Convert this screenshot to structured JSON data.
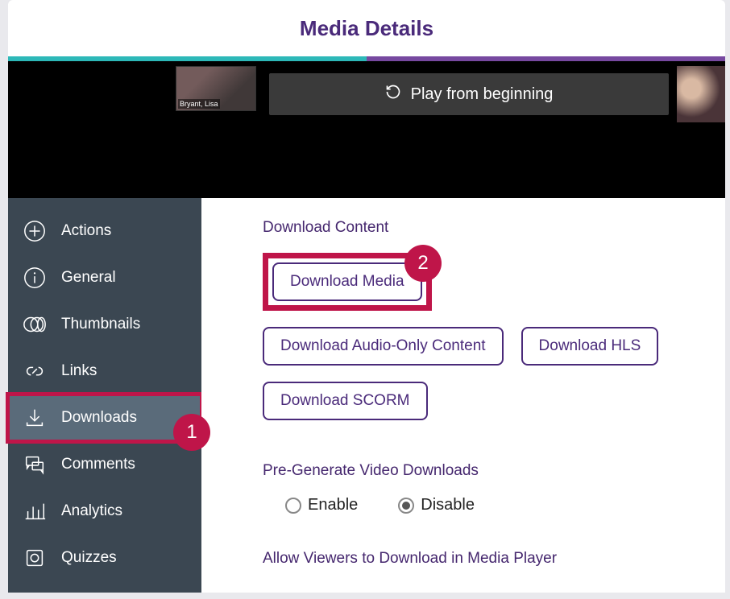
{
  "header": {
    "title": "Media Details"
  },
  "player": {
    "thumb_label": "Bryant, Lisa",
    "play_label": "Play from beginning"
  },
  "sidebar": {
    "items": [
      {
        "label": "Actions"
      },
      {
        "label": "General"
      },
      {
        "label": "Thumbnails"
      },
      {
        "label": "Links"
      },
      {
        "label": "Downloads"
      },
      {
        "label": "Comments"
      },
      {
        "label": "Analytics"
      },
      {
        "label": "Quizzes"
      }
    ]
  },
  "main": {
    "download_section_title": "Download Content",
    "buttons": {
      "download_media": "Download Media",
      "download_audio": "Download Audio-Only Content",
      "download_hls": "Download HLS",
      "download_scorm": "Download SCORM"
    },
    "pregen_title": "Pre-Generate Video Downloads",
    "radio": {
      "enable": "Enable",
      "disable": "Disable",
      "selected": "disable"
    },
    "allow_title": "Allow Viewers to Download in Media Player"
  },
  "callouts": {
    "one": "1",
    "two": "2"
  }
}
